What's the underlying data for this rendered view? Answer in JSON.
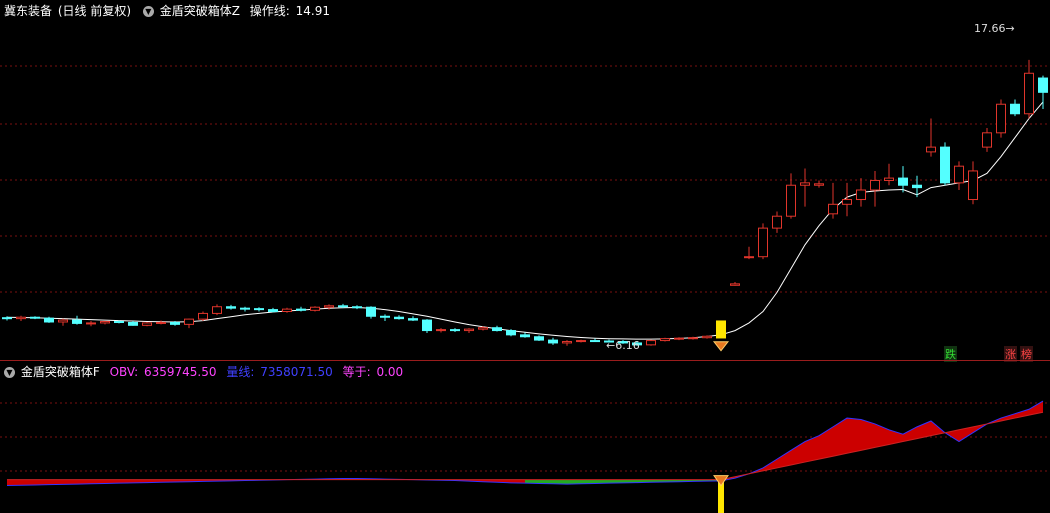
{
  "header": {
    "stock_title": "冀东装备",
    "period": "(日线 前复权)",
    "indicator_name": "金盾突破箱体Z",
    "line_label": "操作线:",
    "line_value": "14.91"
  },
  "sub_header": {
    "indicator_name": "金盾突破箱体F",
    "obv_label": "OBV:",
    "obv_value": "6359745.50",
    "ma_label": "量线:",
    "ma_value": "7358071.50",
    "eq_label": "等于:",
    "eq_value": "0.00"
  },
  "annotations": {
    "high": "17.66",
    "low": "6.16",
    "limit_down": "跌",
    "limit_up_1": "涨",
    "limit_up_2": "榜"
  },
  "colors": {
    "up": "#e0352b",
    "down": "#54ffff",
    "ma": "#ffffff",
    "signal": "#ffe600",
    "obv_fill_pos": "#cc0000",
    "obv_fill_neg": "#22aa22",
    "obv_line": "#3333ff",
    "grid": "#7a1010"
  },
  "chart_data": {
    "type": "candlestick",
    "candles": [
      [
        6.84,
        6.9,
        6.72,
        6.8
      ],
      [
        6.8,
        6.92,
        6.7,
        6.86
      ],
      [
        6.86,
        6.9,
        6.78,
        6.82
      ],
      [
        6.82,
        6.88,
        6.62,
        6.66
      ],
      [
        6.66,
        6.8,
        6.5,
        6.74
      ],
      [
        6.74,
        6.92,
        6.55,
        6.6
      ],
      [
        6.6,
        6.7,
        6.48,
        6.62
      ],
      [
        6.62,
        6.7,
        6.56,
        6.68
      ],
      [
        6.68,
        6.72,
        6.6,
        6.64
      ],
      [
        6.64,
        6.7,
        6.5,
        6.52
      ],
      [
        6.52,
        6.66,
        6.48,
        6.62
      ],
      [
        6.62,
        6.72,
        6.56,
        6.64
      ],
      [
        6.64,
        6.7,
        6.5,
        6.56
      ],
      [
        6.56,
        6.8,
        6.4,
        6.78
      ],
      [
        6.78,
        7.1,
        6.7,
        7.02
      ],
      [
        7.02,
        7.4,
        6.95,
        7.3
      ],
      [
        7.3,
        7.38,
        7.18,
        7.24
      ],
      [
        7.24,
        7.3,
        7.1,
        7.22
      ],
      [
        7.22,
        7.28,
        7.1,
        7.18
      ],
      [
        7.18,
        7.25,
        7.06,
        7.1
      ],
      [
        7.1,
        7.26,
        7.05,
        7.2
      ],
      [
        7.2,
        7.3,
        7.1,
        7.15
      ],
      [
        7.15,
        7.32,
        7.1,
        7.28
      ],
      [
        7.28,
        7.4,
        7.18,
        7.34
      ],
      [
        7.34,
        7.42,
        7.24,
        7.3
      ],
      [
        7.3,
        7.36,
        7.2,
        7.28
      ],
      [
        7.28,
        7.32,
        6.8,
        6.9
      ],
      [
        6.9,
        6.98,
        6.7,
        6.86
      ],
      [
        6.86,
        6.94,
        6.76,
        6.8
      ],
      [
        6.8,
        6.9,
        6.7,
        6.74
      ],
      [
        6.74,
        6.78,
        6.2,
        6.3
      ],
      [
        6.3,
        6.4,
        6.22,
        6.34
      ],
      [
        6.34,
        6.4,
        6.24,
        6.3
      ],
      [
        6.3,
        6.4,
        6.2,
        6.36
      ],
      [
        6.36,
        6.48,
        6.3,
        6.42
      ],
      [
        6.42,
        6.5,
        6.26,
        6.3
      ],
      [
        6.3,
        6.36,
        6.06,
        6.12
      ],
      [
        6.12,
        6.22,
        6.0,
        6.04
      ],
      [
        6.04,
        6.1,
        5.86,
        5.9
      ],
      [
        5.9,
        6.0,
        5.7,
        5.78
      ],
      [
        5.78,
        5.9,
        5.66,
        5.84
      ],
      [
        5.84,
        5.92,
        5.8,
        5.88
      ],
      [
        5.88,
        5.96,
        5.82,
        5.86
      ],
      [
        5.86,
        5.92,
        5.8,
        5.84
      ],
      [
        5.84,
        5.9,
        5.74,
        5.78
      ],
      [
        5.78,
        5.86,
        5.66,
        5.7
      ],
      [
        5.7,
        5.92,
        5.66,
        5.88
      ],
      [
        5.88,
        6.0,
        5.84,
        5.96
      ],
      [
        5.96,
        6.02,
        5.9,
        5.98
      ],
      [
        5.98,
        6.04,
        5.92,
        6.0
      ],
      [
        6.0,
        6.1,
        5.96,
        6.06
      ],
      [
        6.06,
        6.64,
        6.02,
        6.54
      ],
      [
        8.2,
        8.34,
        8.18,
        8.26
      ],
      [
        9.36,
        9.82,
        9.3,
        9.4
      ],
      [
        9.4,
        10.8,
        9.3,
        10.6
      ],
      [
        10.6,
        11.3,
        10.4,
        11.1
      ],
      [
        11.1,
        12.9,
        11.0,
        12.4
      ],
      [
        12.4,
        13.1,
        11.5,
        12.5
      ],
      [
        12.4,
        12.6,
        12.3,
        12.46
      ],
      [
        11.2,
        12.5,
        11.0,
        11.6
      ],
      [
        11.6,
        12.5,
        11.1,
        11.8
      ],
      [
        11.8,
        12.7,
        11.5,
        12.2
      ],
      [
        12.2,
        13.0,
        11.5,
        12.6
      ],
      [
        12.6,
        13.3,
        12.4,
        12.7
      ],
      [
        12.7,
        13.2,
        12.1,
        12.4
      ],
      [
        12.4,
        12.8,
        11.9,
        12.3
      ],
      [
        13.8,
        15.2,
        13.6,
        14.0
      ],
      [
        14.0,
        14.2,
        12.4,
        12.5
      ],
      [
        12.5,
        13.4,
        12.2,
        13.2
      ],
      [
        11.8,
        13.4,
        11.6,
        13.0
      ],
      [
        14.0,
        14.8,
        13.8,
        14.6
      ],
      [
        14.6,
        16.0,
        14.4,
        15.8
      ],
      [
        15.8,
        16.0,
        15.3,
        15.4
      ],
      [
        15.4,
        17.66,
        15.2,
        17.1
      ],
      [
        16.9,
        17.0,
        15.6,
        16.3
      ]
    ],
    "ma": [
      6.86,
      6.85,
      6.84,
      6.82,
      6.8,
      6.78,
      6.76,
      6.74,
      6.72,
      6.7,
      6.68,
      6.67,
      6.66,
      6.67,
      6.72,
      6.8,
      6.88,
      6.96,
      7.02,
      7.08,
      7.12,
      7.16,
      7.2,
      7.24,
      7.26,
      7.27,
      7.24,
      7.18,
      7.1,
      7.0,
      6.9,
      6.78,
      6.66,
      6.55,
      6.46,
      6.38,
      6.3,
      6.23,
      6.16,
      6.1,
      6.05,
      6.01,
      5.98,
      5.96,
      5.95,
      5.94,
      5.94,
      5.95,
      5.97,
      6.0,
      6.05,
      6.12,
      6.3,
      6.62,
      7.1,
      7.9,
      8.9,
      9.9,
      10.7,
      11.4,
      11.9,
      12.1,
      12.16,
      12.2,
      12.22,
      12.0,
      12.3,
      12.4,
      12.5,
      12.6,
      12.9,
      13.6,
      14.4,
      15.2,
      15.9
    ],
    "obv": [
      0.6,
      0.62,
      0.64,
      0.66,
      0.68,
      0.7,
      0.72,
      0.74,
      0.76,
      0.78,
      0.8,
      0.82,
      0.84,
      0.86,
      0.88,
      0.9,
      0.92,
      0.94,
      0.96,
      0.98,
      1.0,
      1.02,
      1.04,
      1.06,
      1.08,
      1.08,
      1.06,
      1.04,
      1.02,
      1.0,
      0.98,
      0.96,
      0.94,
      0.9,
      0.86,
      0.82,
      0.78,
      0.76,
      0.74,
      0.72,
      0.7,
      0.72,
      0.74,
      0.76,
      0.78,
      0.8,
      0.82,
      0.84,
      0.86,
      0.88,
      0.9,
      0.92,
      1.1,
      1.4,
      1.8,
      2.4,
      3.0,
      3.6,
      4.0,
      4.6,
      5.2,
      5.1,
      4.8,
      4.4,
      4.1,
      4.6,
      5.0,
      4.2,
      3.6,
      4.2,
      4.8,
      5.2,
      5.5,
      5.8,
      6.36
    ],
    "obv_ma": [
      1.0,
      1.0,
      1.0,
      1.0,
      1.0,
      1.0,
      1.0,
      1.0,
      1.0,
      1.0,
      1.0,
      1.0,
      1.0,
      1.0,
      1.0,
      1.0,
      1.0,
      1.0,
      1.0,
      1.0,
      1.0,
      1.0,
      1.0,
      1.0,
      1.0,
      1.0,
      1.0,
      1.0,
      1.0,
      1.0,
      1.0,
      1.0,
      1.0,
      1.0,
      1.0,
      1.0,
      1.0,
      1.0,
      1.0,
      1.0,
      1.0,
      1.0,
      1.0,
      1.0,
      1.0,
      1.0,
      1.0,
      1.0,
      1.0,
      1.0,
      1.0,
      1.0,
      1.2,
      1.4,
      1.6,
      1.8,
      2.0,
      2.2,
      2.4,
      2.6,
      2.8,
      3.0,
      3.2,
      3.4,
      3.6,
      3.8,
      4.0,
      4.2,
      4.4,
      4.6,
      4.8,
      5.0,
      5.2,
      5.4,
      5.6
    ],
    "signal_index": 51,
    "ylim": [
      5.4,
      19.0
    ],
    "obv_ylim": [
      -1.0,
      8.0
    ]
  }
}
